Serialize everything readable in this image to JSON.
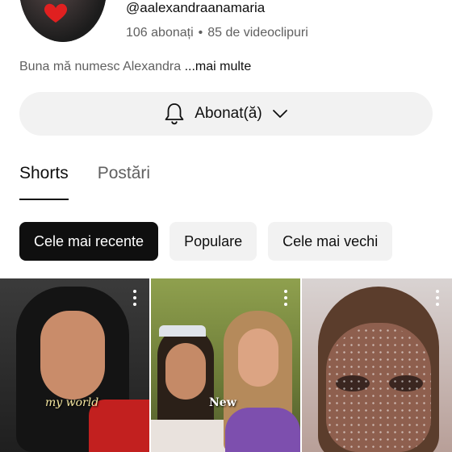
{
  "channel": {
    "handle": "@aalexandraanamaria",
    "subscribers": "106 abonați",
    "separator": "•",
    "videos": "85 de videoclipuri",
    "description": "Buna mă numesc Alexandra",
    "more_label": "...mai multe"
  },
  "subscribe_button": {
    "label": "Abonat(ă)",
    "icon": "bell-icon",
    "dropdown_icon": "chevron-down-icon"
  },
  "tabs": [
    {
      "label": "Shorts",
      "active": true
    },
    {
      "label": "Postări",
      "active": false
    }
  ],
  "filters": [
    {
      "label": "Cele mai recente",
      "active": true
    },
    {
      "label": "Populare",
      "active": false
    },
    {
      "label": "Cele mai vechi",
      "active": false
    }
  ],
  "shorts": [
    {
      "caption": "my world"
    },
    {
      "caption": "New"
    },
    {
      "caption": ""
    }
  ],
  "colors": {
    "text_primary": "#0f0f0f",
    "text_secondary": "#606060",
    "chip_background": "#f2f2f2",
    "chip_active_background": "#0f0f0f"
  }
}
